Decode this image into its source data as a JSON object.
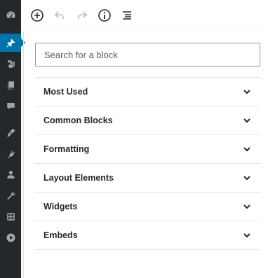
{
  "sidebar": {
    "items": [
      {
        "icon": "dashboard-icon",
        "active": false
      },
      {
        "icon": "pushpin-icon",
        "active": true
      },
      {
        "icon": "media-icon",
        "active": false
      },
      {
        "icon": "pages-icon",
        "active": false
      },
      {
        "icon": "comments-icon",
        "active": false
      },
      {
        "icon": "appearance-icon",
        "active": false
      },
      {
        "icon": "plugins-icon",
        "active": false
      },
      {
        "icon": "users-icon",
        "active": false
      },
      {
        "icon": "tools-icon",
        "active": false
      },
      {
        "icon": "settings-icon",
        "active": false
      },
      {
        "icon": "play-icon",
        "active": false
      }
    ]
  },
  "toolbar": {
    "buttons": [
      "add-block-icon",
      "undo-icon",
      "redo-icon",
      "info-icon",
      "outline-icon"
    ]
  },
  "inserter": {
    "search_placeholder": "Search for a block",
    "categories": [
      {
        "label": "Most Used"
      },
      {
        "label": "Common Blocks"
      },
      {
        "label": "Formatting"
      },
      {
        "label": "Layout Elements"
      },
      {
        "label": "Widgets"
      },
      {
        "label": "Embeds"
      }
    ]
  },
  "colors": {
    "sidebar_bg": "#23282d",
    "accent": "#0073aa",
    "icon_inactive": "#a0a5aa",
    "divider": "#e2e4e7"
  }
}
